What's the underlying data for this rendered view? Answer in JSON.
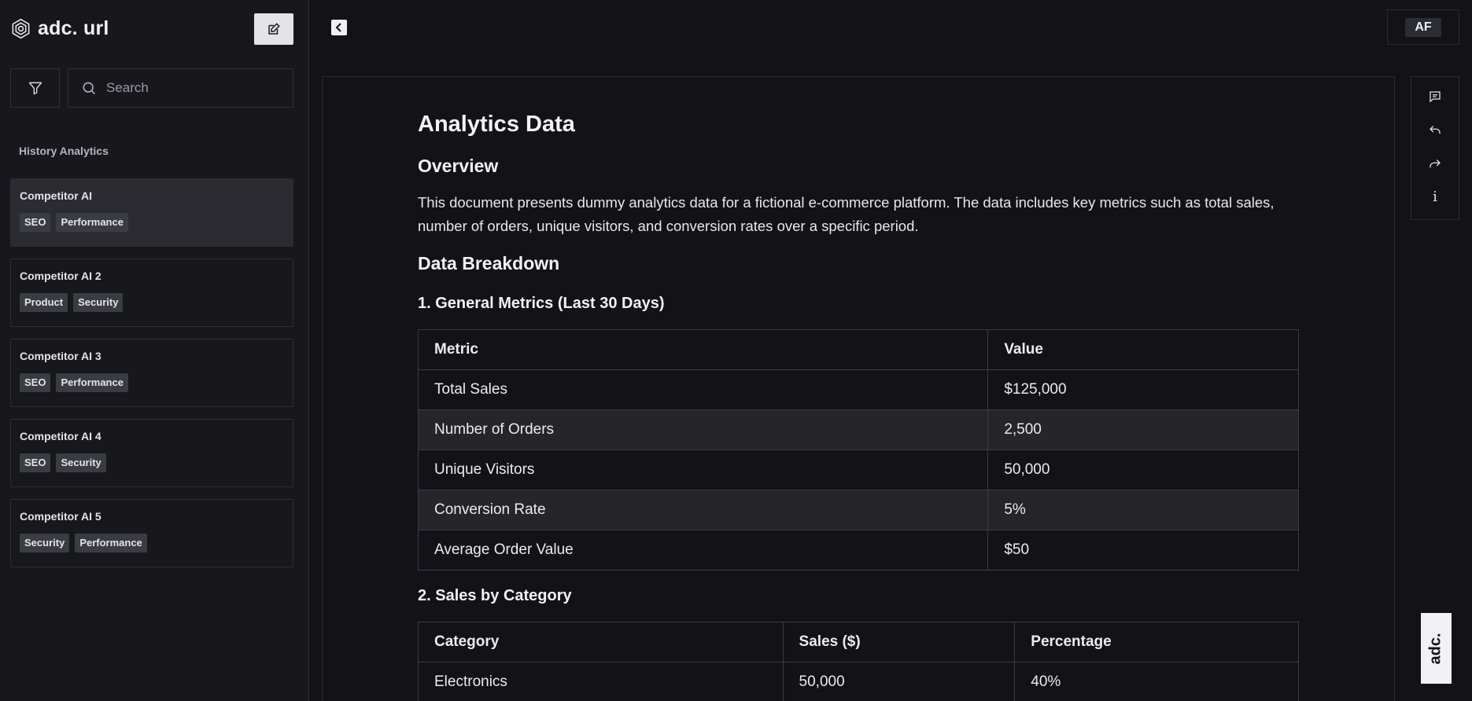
{
  "app": {
    "brand": "adc. url",
    "avatar_initials": "AF",
    "badge_text": "adc."
  },
  "search": {
    "placeholder": "Search"
  },
  "sidebar": {
    "section_title": "History Analytics",
    "items": [
      {
        "title": "Competitor AI",
        "tags": [
          "SEO",
          "Performance"
        ],
        "active": true
      },
      {
        "title": "Competitor AI 2",
        "tags": [
          "Product",
          "Security"
        ]
      },
      {
        "title": "Competitor AI 3",
        "tags": [
          "SEO",
          "Performance"
        ]
      },
      {
        "title": "Competitor AI 4",
        "tags": [
          "SEO",
          "Security"
        ]
      },
      {
        "title": "Competitor AI 5",
        "tags": [
          "Security",
          "Performance"
        ]
      }
    ]
  },
  "document": {
    "title": "Analytics Data",
    "overview_heading": "Overview",
    "overview_text": "This document presents dummy analytics data for a fictional e-commerce platform. The data includes key metrics such as total sales, number of orders, unique visitors, and conversion rates over a specific period.",
    "breakdown_heading": "Data Breakdown",
    "general": {
      "heading": "1. General Metrics (Last 30 Days)",
      "columns": [
        "Metric",
        "Value"
      ],
      "rows": [
        [
          "Total Sales",
          "$125,000"
        ],
        [
          "Number of Orders",
          "2,500"
        ],
        [
          "Unique Visitors",
          "50,000"
        ],
        [
          "Conversion Rate",
          "5%"
        ],
        [
          "Average Order Value",
          "$50"
        ]
      ]
    },
    "category": {
      "heading": "2. Sales by Category",
      "columns": [
        "Category",
        "Sales ($)",
        "Percentage"
      ],
      "rows": [
        [
          "Electronics",
          "50,000",
          "40%"
        ]
      ]
    }
  },
  "rail": {
    "icons": [
      "comment-icon",
      "undo-icon",
      "redo-icon",
      "info-icon"
    ],
    "info_glyph": "i"
  },
  "colors": {
    "background": "#131317",
    "sidebar": "#18181c",
    "active_card": "#2b2b31",
    "tag": "#3b3b43",
    "alt_row": "#25252a"
  }
}
